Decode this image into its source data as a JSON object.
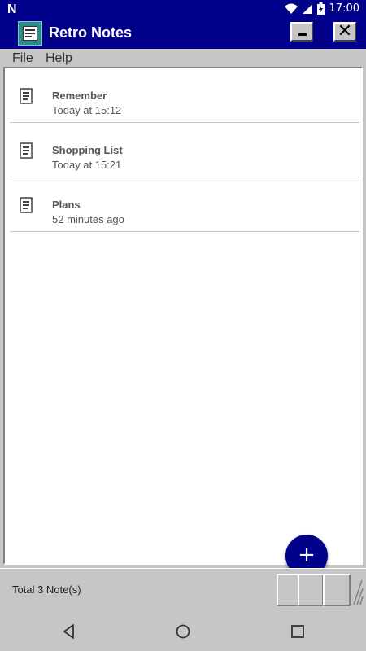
{
  "status_bar": {
    "carrier_icon": "n-notification-icon",
    "time": "17:00",
    "icons": [
      "wifi-icon",
      "cell-signal-icon",
      "battery-charging-icon"
    ]
  },
  "window": {
    "title": "Retro Notes",
    "icon": "notes-app-icon",
    "minimize_icon": "minimize-icon",
    "close_icon": "close-icon"
  },
  "menu": {
    "items": [
      "File",
      "Help"
    ]
  },
  "notes": [
    {
      "title": "Remember",
      "timestamp": "Today at 15:12",
      "icon": "note-icon"
    },
    {
      "title": "Shopping List",
      "timestamp": "Today at 15:21",
      "icon": "note-icon"
    },
    {
      "title": "Plans",
      "timestamp": "52 minutes ago",
      "icon": "note-icon"
    }
  ],
  "fab": {
    "icon": "plus-icon",
    "symbol": "+"
  },
  "footer": {
    "total_label": "Total 3 Note(s)"
  },
  "nav": {
    "icons": [
      "back-icon",
      "home-icon",
      "recents-icon"
    ]
  },
  "colors": {
    "title_bar": "#00008b",
    "window_face": "#c6c6c6",
    "fab": "#00008b",
    "content_bg": "#ffffff"
  }
}
